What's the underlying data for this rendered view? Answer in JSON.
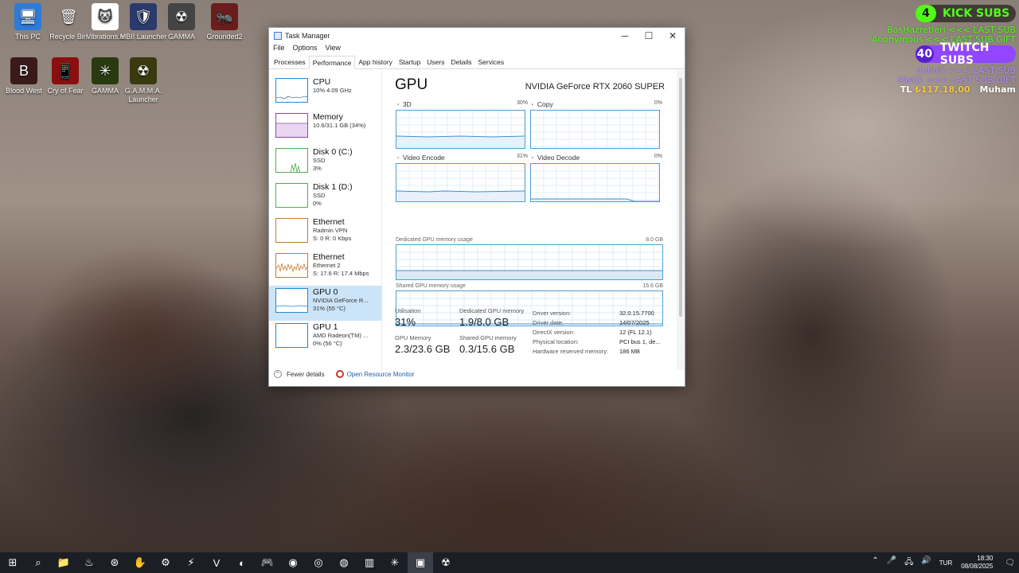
{
  "desktop": {
    "icons": [
      {
        "label": "This PC",
        "glyph": "🖥"
      },
      {
        "label": "Recycle Bin",
        "glyph": "🗑"
      },
      {
        "label": "Vibrations.e",
        "glyph": "🐱"
      },
      {
        "label": "MBII Launcher",
        "glyph": "🛡"
      },
      {
        "label": "GAMMA",
        "glyph": "☢"
      },
      {
        "label": "Grounded2",
        "glyph": "🐜"
      },
      {
        "label": "Blood West",
        "glyph": "B"
      },
      {
        "label": "Cry of Fear",
        "glyph": "📱"
      },
      {
        "label": "GAMMA",
        "glyph": "✳"
      },
      {
        "label": "G.A.M.M.A. Launcher",
        "glyph": "☢"
      }
    ]
  },
  "overlay": {
    "kick_count": "4",
    "kick_label": "KICK SUBS",
    "kick_line1": "BosHazretleri <<< LAST SUB",
    "kick_line2": "Anonymous <<< LAST SUB GIFT",
    "twitch_count": "40",
    "twitch_label": "TWITCH SUBS",
    "twitch_line1": "onlinik <<< LAST SUB",
    "twitch_line2": "Mistik <<< LAST SUB GIFT",
    "donation_prefix": "TL",
    "donation_amount": "₺117.18,00",
    "donation_name": "Muham",
    "kick_color": "#53fc18",
    "twitch_color": "#9146ff"
  },
  "window": {
    "title": "Task Manager",
    "minimize": "─",
    "maximize": "☐",
    "close": "✕",
    "menu": [
      "File",
      "Options",
      "View"
    ],
    "tabs": [
      "Processes",
      "Performance",
      "App history",
      "Startup",
      "Users",
      "Details",
      "Services"
    ],
    "active_tab": "Performance"
  },
  "sidebar": [
    {
      "name": "CPU",
      "line1": "10% 4.09 GHz",
      "line2": "",
      "line3": "",
      "color": "#1e8ad6"
    },
    {
      "name": "Memory",
      "line1": "10.6/31.1 GB (34%)",
      "line2": "",
      "line3": "",
      "color": "#8e44ad"
    },
    {
      "name": "Disk 0 (C:)",
      "line1": "SSD",
      "line2": "3%",
      "line3": "",
      "color": "#4caf50"
    },
    {
      "name": "Disk 1 (D:)",
      "line1": "SSD",
      "line2": "0%",
      "line3": "",
      "color": "#4caf50"
    },
    {
      "name": "Ethernet",
      "line1": "Radmin VPN",
      "line2": "S: 0 R: 0 Kbps",
      "line3": "",
      "color": "#c77a32"
    },
    {
      "name": "Ethernet",
      "line1": "Ethernet 2",
      "line2": "S: 17.6 R: 17.4 Mbps",
      "line3": "",
      "color": "#c77a32"
    },
    {
      "name": "GPU 0",
      "line1": "NVIDIA GeForce R...",
      "line2": "31% (55 °C)",
      "line3": "",
      "color": "#1e8ad6"
    },
    {
      "name": "GPU 1",
      "line1": "AMD Radeon(TM) ...",
      "line2": "0% (56 °C)",
      "line3": "",
      "color": "#1e8ad6"
    }
  ],
  "gpu": {
    "title": "GPU",
    "model": "NVIDIA GeForce RTX 2060 SUPER",
    "engines": [
      {
        "name": "3D",
        "pct": "30%"
      },
      {
        "name": "Copy",
        "pct": "0%"
      },
      {
        "name": "Video Encode",
        "pct": "31%"
      },
      {
        "name": "Video Decode",
        "pct": "0%"
      }
    ],
    "dedicated_label": "Dedicated GPU memory usage",
    "dedicated_max": "8.0 GB",
    "shared_label": "Shared GPU memory usage",
    "shared_max": "15.6 GB",
    "stats": {
      "utilisation_label": "Utilisation",
      "utilisation": "31%",
      "dedicated_label": "Dedicated GPU memory",
      "dedicated": "1.9/8.0 GB",
      "gpu_memory_label": "GPU Memory",
      "gpu_memory": "2.3/23.6 GB",
      "shared_label": "Shared GPU memory",
      "shared": "0.3/15.6 GB"
    },
    "details": [
      {
        "k": "Driver version:",
        "v": "32.0.15.7700"
      },
      {
        "k": "Driver date:",
        "v": "14/07/2025"
      },
      {
        "k": "DirectX version:",
        "v": "12 (FL 12.1)"
      },
      {
        "k": "Physical location:",
        "v": "PCI bus 1, de..."
      },
      {
        "k": "Hardware reserved memory:",
        "v": "186 MB"
      }
    ]
  },
  "footer": {
    "fewer_details": "Fewer details",
    "open_resource_monitor": "Open Resource Monitor"
  },
  "taskbar": {
    "apps": [
      "⊞",
      "⌕",
      "📁",
      "♨",
      "⊛",
      "✋",
      "⚙",
      "⚡",
      "V",
      "◐",
      "🎮",
      "◉",
      "◎",
      "◍",
      "▥",
      "✳",
      "▣",
      "☢"
    ],
    "active_index": 16,
    "tray_icons": [
      "⌃",
      "🎤",
      "🖧",
      "🔊"
    ],
    "language": "TUR",
    "time": "18:30",
    "date": "08/08/2025",
    "notification": "🗨"
  }
}
